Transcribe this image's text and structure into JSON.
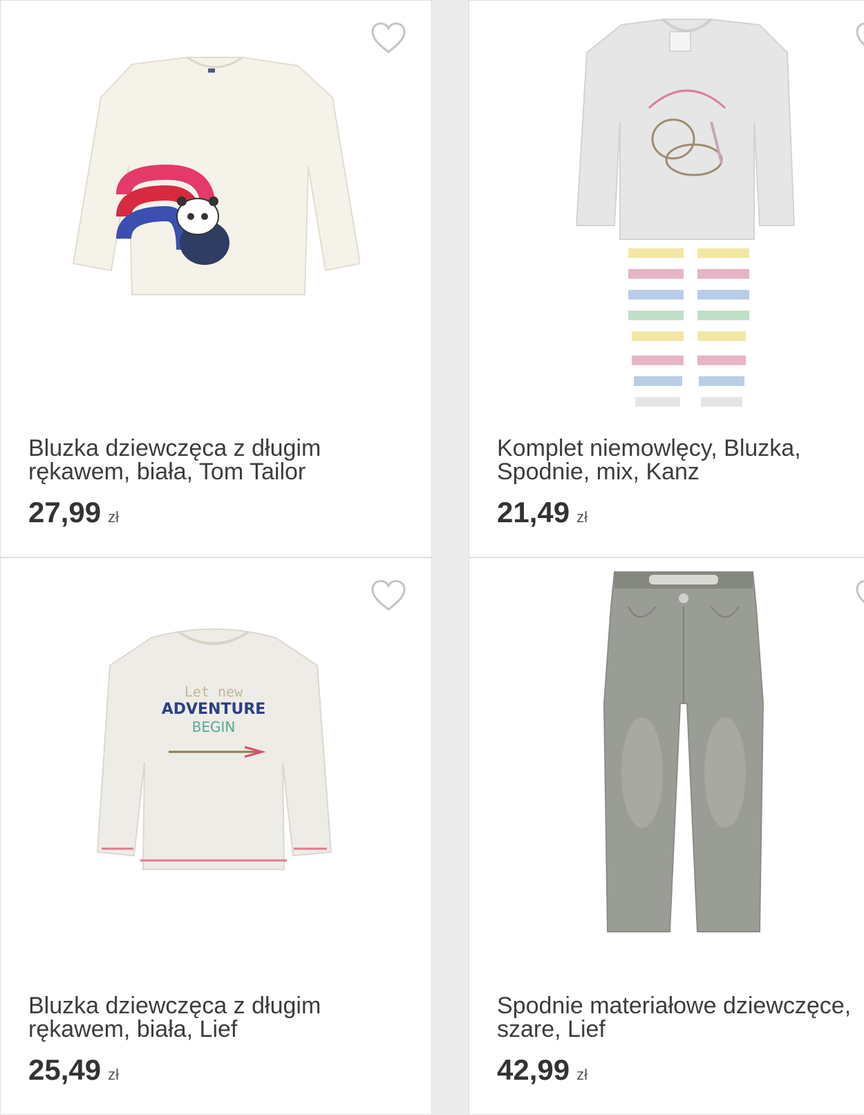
{
  "products": [
    {
      "title": "Bluzka dziewczęca z długim rękawem, biała, Tom Tailor",
      "price": "27,99",
      "currency": "zł",
      "fav_icon": "heart-outline-icon"
    },
    {
      "title": "Komplet niemowlęcy, Bluzka, Spodnie, mix, Kanz",
      "price": "21,49",
      "currency": "zł",
      "fav_icon": "heart-outline-icon"
    },
    {
      "title": "Bluzka dziewczęca z długim rękawem, biała, Lief",
      "price": "25,49",
      "currency": "zł",
      "fav_icon": "heart-outline-icon"
    },
    {
      "title": "Spodnie materiałowe dziewczęce, szare, Lief",
      "price": "42,99",
      "currency": "zł",
      "fav_icon": "heart-outline-icon"
    }
  ],
  "colors": {
    "background": "#ebebeb",
    "card": "#ffffff",
    "text": "#3a3a3a",
    "heart": "#bdbdbd"
  }
}
